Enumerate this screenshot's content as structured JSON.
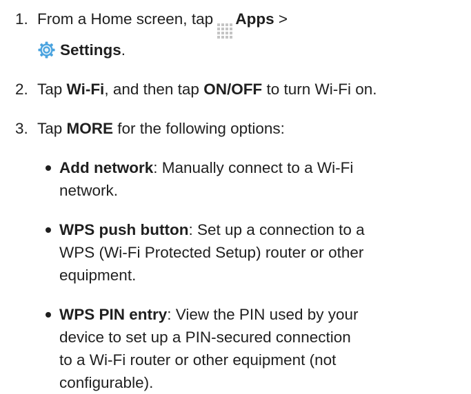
{
  "steps": [
    {
      "number": "1.",
      "text_1": "From a Home screen, tap ",
      "apps_icon": "apps-grid-icon",
      "apps_label": "Apps",
      "text_2": " >",
      "settings_icon": "gear-icon",
      "settings_label": "Settings",
      "text_3": "."
    },
    {
      "number": "2.",
      "text_1": "Tap ",
      "wifi_label": "Wi-Fi",
      "text_2": ", and then tap ",
      "onoff_label": "ON/OFF",
      "text_3": " to turn Wi-Fi on."
    },
    {
      "number": "3.",
      "text_1": "Tap ",
      "more_label": "MORE",
      "text_2": " for the following options:"
    }
  ],
  "options": [
    {
      "term": "Add network",
      "description_line1": ": Manually connect to a Wi-Fi",
      "description_line2": "network."
    },
    {
      "term": "WPS push button",
      "description_line1": ": Set up a connection to a",
      "description_line2": "WPS (Wi-Fi Protected Setup) router or other",
      "description_line3": "equipment."
    },
    {
      "term": "WPS PIN entry",
      "description_line1": ": View the PIN used by your",
      "description_line2": "device to set up a PIN-secured connection",
      "description_line3": "to a Wi-Fi router or other equipment (not",
      "description_line4": "configurable)."
    }
  ],
  "colors": {
    "text": "#1f1f1f",
    "apps_icon": "#c5c5c5",
    "settings_icon_outer": "#4aa3df",
    "settings_icon_inner": "#e8f4fb"
  }
}
